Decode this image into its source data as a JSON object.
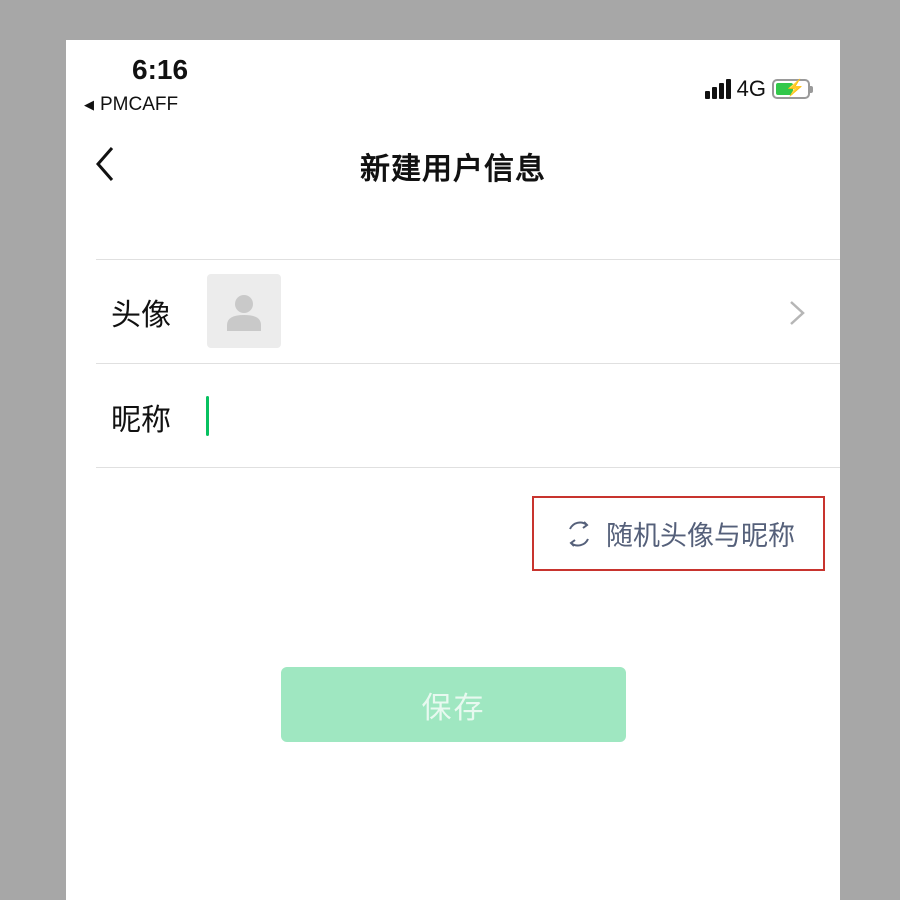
{
  "status_bar": {
    "time": "6:16",
    "back_app": "PMCAFF",
    "back_arrow": "◀",
    "network": "4G",
    "signal_icon": "signal-bars-icon",
    "battery_icon": "battery-charging-icon"
  },
  "nav": {
    "title": "新建用户信息",
    "back_icon": "chevron-left-icon"
  },
  "form": {
    "avatar_label": "头像",
    "nickname_label": "昵称",
    "nickname_value": ""
  },
  "random": {
    "label": "随机头像与昵称",
    "icon": "refresh-icon"
  },
  "save": {
    "label": "保存"
  },
  "colors": {
    "accent": "#07c160",
    "save_disabled_bg": "#9fe7c1",
    "highlight_border": "#c8342e",
    "link_text": "#55607a"
  }
}
